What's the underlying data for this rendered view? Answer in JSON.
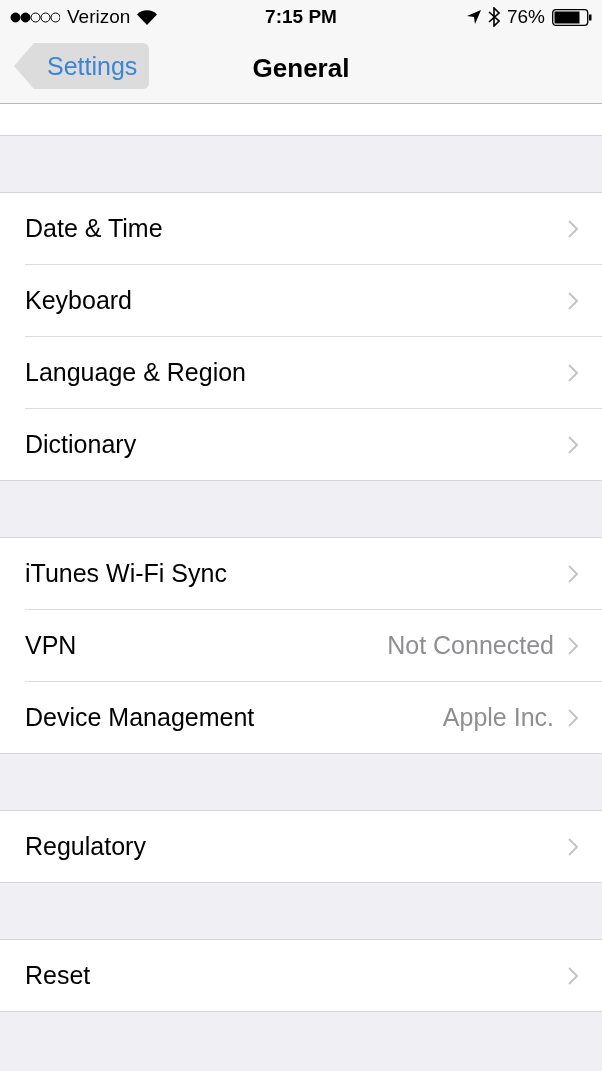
{
  "status_bar": {
    "carrier": "Verizon",
    "time": "7:15 PM",
    "battery": "76%"
  },
  "nav_bar": {
    "back": "Settings",
    "title": "General"
  },
  "groups": [
    {
      "rows": [
        {
          "label": "Date & Time"
        },
        {
          "label": "Keyboard"
        },
        {
          "label": "Language & Region"
        },
        {
          "label": "Dictionary"
        }
      ]
    },
    {
      "rows": [
        {
          "label": "iTunes Wi-Fi Sync"
        },
        {
          "label": "VPN",
          "value": "Not Connected"
        },
        {
          "label": "Device Management",
          "value": "Apple Inc."
        }
      ]
    },
    {
      "rows": [
        {
          "label": "Regulatory"
        }
      ]
    },
    {
      "rows": [
        {
          "label": "Reset"
        }
      ]
    }
  ]
}
